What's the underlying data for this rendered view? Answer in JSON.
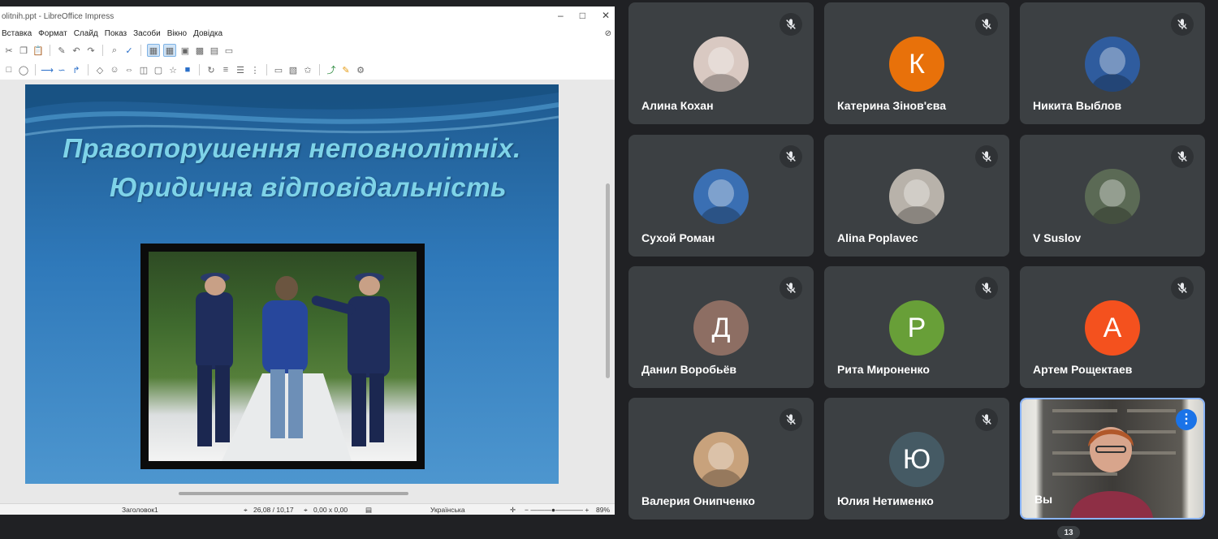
{
  "presentation": {
    "window_title": "olitnih.ppt - LibreOffice Impress",
    "menu": [
      "Вставка",
      "Формат",
      "Слайд",
      "Показ",
      "Засоби",
      "Вікно",
      "Довідка"
    ],
    "slide": {
      "title_line1": "Правопорушення неповнолітніх.",
      "title_line2": "Юридична відповідальність"
    },
    "status": {
      "layout": "Заголовок1",
      "position": "26,08 / 10,17",
      "size": "0,00 x 0,00",
      "language": "Українська",
      "zoom": "89%"
    }
  },
  "participants": [
    {
      "name": "Алина Кохан",
      "avatar": "photo",
      "color": "#d9c9c2"
    },
    {
      "name": "Катерина Зінов'єва",
      "avatar": "К",
      "color": "#e8710a"
    },
    {
      "name": "Никита Выблов",
      "avatar": "photo",
      "color": "#2f5c9e"
    },
    {
      "name": "Сухой Роман",
      "avatar": "photo",
      "color": "#3a6fb3"
    },
    {
      "name": "Alina Poplavec",
      "avatar": "photo",
      "color": "#b8b2aa"
    },
    {
      "name": "V Suslov",
      "avatar": "photo",
      "color": "#5b6a55"
    },
    {
      "name": "Данил Воробьёв",
      "avatar": "Д",
      "color": "#8d6e63"
    },
    {
      "name": "Рита Мироненко",
      "avatar": "Р",
      "color": "#689f38"
    },
    {
      "name": "Артем Рощектаев",
      "avatar": "А",
      "color": "#f4511e"
    },
    {
      "name": "Валерия Онипченко",
      "avatar": "photo",
      "color": "#c8a27c"
    },
    {
      "name": "Юлия Нетименко",
      "avatar": "Ю",
      "color": "#455a64"
    }
  ],
  "self_tile": {
    "name": "Вы",
    "more_icon": "more-vert-icon"
  },
  "participant_count": "13",
  "icons": {
    "muted": "mic-off-icon"
  }
}
